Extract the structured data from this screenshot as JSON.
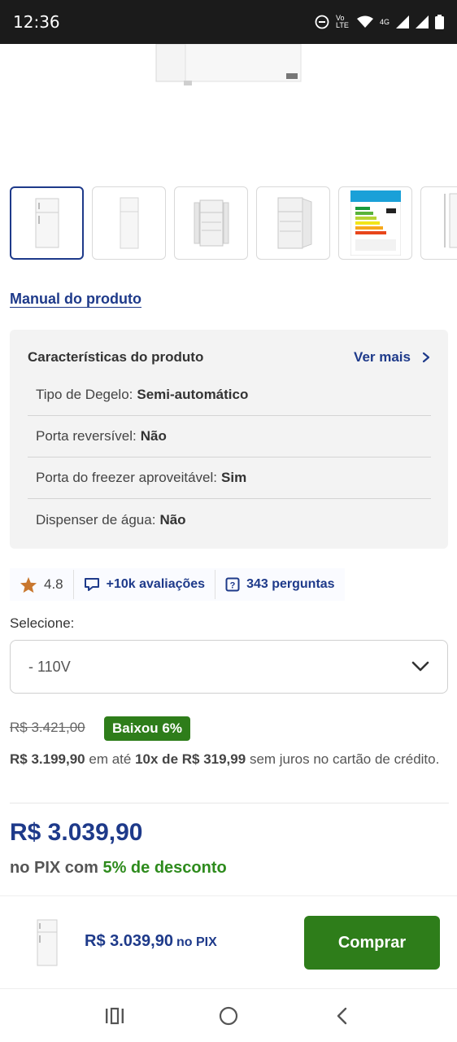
{
  "status_bar": {
    "time": "12:36",
    "network": "4G",
    "lte_label": "Vo LTE"
  },
  "thumbnails": [
    {
      "kind": "fridge-closed",
      "selected": true
    },
    {
      "kind": "fridge-closed-side",
      "selected": false
    },
    {
      "kind": "fridge-open",
      "selected": false
    },
    {
      "kind": "fridge-open-angle",
      "selected": false
    },
    {
      "kind": "energy-label",
      "selected": false
    },
    {
      "kind": "dimensions",
      "selected": false
    }
  ],
  "manual_link": "Manual do produto",
  "specs": {
    "title": "Características do produto",
    "see_more": "Ver mais",
    "rows": [
      {
        "label": "Tipo de Degelo:",
        "value": "Semi-automático"
      },
      {
        "label": "Porta reversível:",
        "value": "Não"
      },
      {
        "label": "Porta do freezer aproveitável:",
        "value": "Sim"
      },
      {
        "label": "Dispenser de água:",
        "value": "Não"
      }
    ]
  },
  "rating": {
    "score": "4.8",
    "reviews": "+10k avaliações",
    "questions": "343 perguntas"
  },
  "select": {
    "label": "Selecione:",
    "value": "- 110V"
  },
  "pricing": {
    "old_price": "R$ 3.421,00",
    "discount_badge": "Baixou 6%",
    "installment_price": "R$ 3.199,90",
    "installment_mid": "em até",
    "installment_count": "10x de R$ 319,99",
    "installment_tail": "sem juros no cartão de crédito.",
    "pix_price": "R$ 3.039,90",
    "pix_prefix": "no PIX com",
    "pix_discount": "5% de desconto"
  },
  "buy_bar": {
    "price": "R$ 3.039,90",
    "price_suffix": "no PIX",
    "button": "Comprar"
  },
  "colors": {
    "brand_blue": "#1e3a8a",
    "buy_green": "#2e7d1a",
    "discount_green": "#2e8b1d"
  }
}
